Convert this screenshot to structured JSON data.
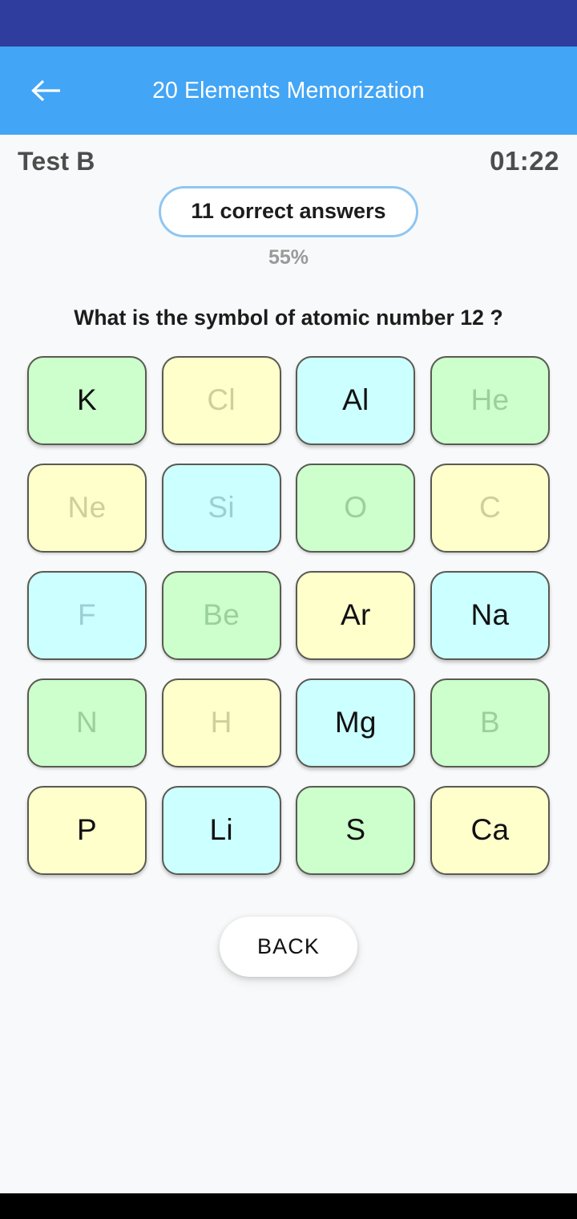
{
  "status_bar": {
    "background": "#2f3e9e"
  },
  "app_bar": {
    "title": "20 Elements Memorization",
    "background": "#42a5f5",
    "back_icon": "arrow-left-icon"
  },
  "test": {
    "name": "Test B",
    "timer": "01:22"
  },
  "score": {
    "pill_label": "11 correct answers",
    "correct_count": 11,
    "percent_label": "55%",
    "percent_value": 55,
    "pill_border_color": "#8fc6f2"
  },
  "question": {
    "text": "What is the symbol of atomic number 12  ?",
    "atomic_number": 12
  },
  "tiles": [
    {
      "symbol": "K",
      "color": "green",
      "state": "active"
    },
    {
      "symbol": "Cl",
      "color": "yellow",
      "state": "used"
    },
    {
      "symbol": "Al",
      "color": "blue",
      "state": "active"
    },
    {
      "symbol": "He",
      "color": "green",
      "state": "used"
    },
    {
      "symbol": "Ne",
      "color": "yellow",
      "state": "used"
    },
    {
      "symbol": "Si",
      "color": "blue",
      "state": "used"
    },
    {
      "symbol": "O",
      "color": "green",
      "state": "used"
    },
    {
      "symbol": "C",
      "color": "yellow",
      "state": "used"
    },
    {
      "symbol": "F",
      "color": "blue",
      "state": "used"
    },
    {
      "symbol": "Be",
      "color": "green",
      "state": "used"
    },
    {
      "symbol": "Ar",
      "color": "yellow",
      "state": "active"
    },
    {
      "symbol": "Na",
      "color": "blue",
      "state": "active"
    },
    {
      "symbol": "N",
      "color": "green",
      "state": "used"
    },
    {
      "symbol": "H",
      "color": "yellow",
      "state": "used"
    },
    {
      "symbol": "Mg",
      "color": "blue",
      "state": "active"
    },
    {
      "symbol": "B",
      "color": "green",
      "state": "used"
    },
    {
      "symbol": "P",
      "color": "yellow",
      "state": "active"
    },
    {
      "symbol": "Li",
      "color": "blue",
      "state": "active"
    },
    {
      "symbol": "S",
      "color": "green",
      "state": "active"
    },
    {
      "symbol": "Ca",
      "color": "yellow",
      "state": "active"
    }
  ],
  "tile_colors": {
    "green": "#ccffcc",
    "yellow": "#ffffcc",
    "blue": "#ccffff"
  },
  "footer": {
    "back_label": "BACK"
  },
  "nav_bar": {
    "background": "#000000"
  }
}
